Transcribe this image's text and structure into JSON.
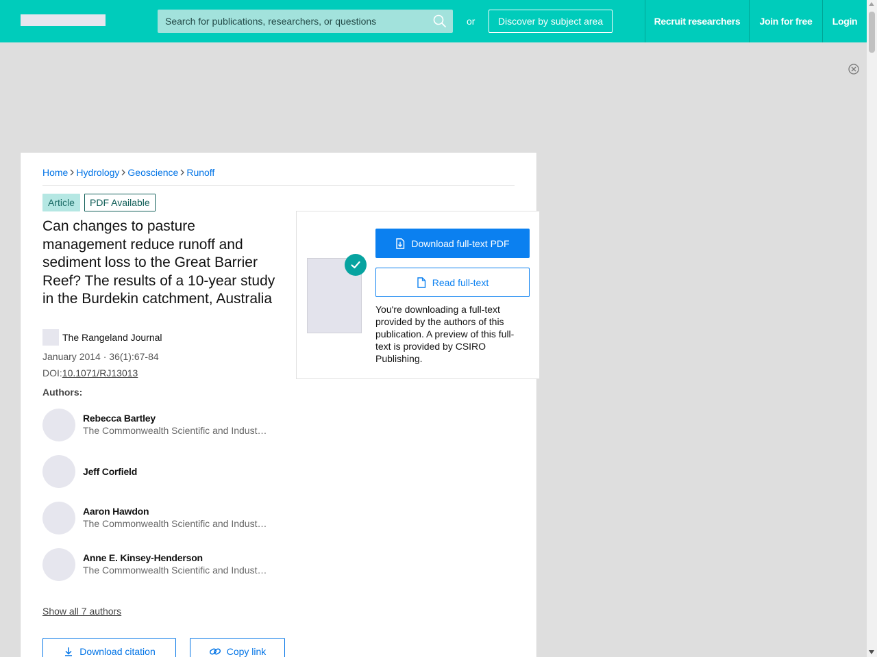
{
  "header": {
    "search_placeholder": "Search for publications, researchers, or questions",
    "or_text": "or",
    "discover_label": "Discover by subject area",
    "nav": {
      "recruit": "Recruit researchers",
      "join": "Join for free",
      "login": "Login"
    }
  },
  "breadcrumb": [
    "Home",
    "Hydrology",
    "Geoscience",
    "Runoff"
  ],
  "badges": {
    "type": "Article",
    "pdf": "PDF Available"
  },
  "article": {
    "title": "Can changes to pasture management reduce runoff and sediment loss to the Great Barrier Reef? The results of a 10-year study in the Burdekin catchment, Australia",
    "journal": "The Rangeland Journal",
    "date_line": "January 2014 · 36(1):67-84",
    "doi_label": "DOI:",
    "doi": "10.1071/RJ13013",
    "authors_label": "Authors:",
    "authors": [
      {
        "name": "Rebecca Bartley",
        "affiliation": "The Commonwealth Scientific and Industrial Research Organisation"
      },
      {
        "name": "Jeff Corfield",
        "affiliation": ""
      },
      {
        "name": "Aaron Hawdon",
        "affiliation": "The Commonwealth Scientific and Industrial Research Organisation"
      },
      {
        "name": "Anne E. Kinsey-Henderson",
        "affiliation": "The Commonwealth Scientific and Industrial Research Organisation"
      }
    ],
    "show_all": "Show all 7 authors",
    "download_citation": "Download citation",
    "copy_link": "Copy link"
  },
  "download_panel": {
    "download_pdf": "Download full-text PDF",
    "read_full_text": "Read full-text",
    "note": "You're downloading a full-text provided by the authors of this publication. A preview of this full-text is provided by CSIRO Publishing."
  },
  "colors": {
    "header_bg": "#00ccbb",
    "link": "#0073e6",
    "primary_button": "#0b80f0",
    "check_badge": "#07a3a0"
  }
}
